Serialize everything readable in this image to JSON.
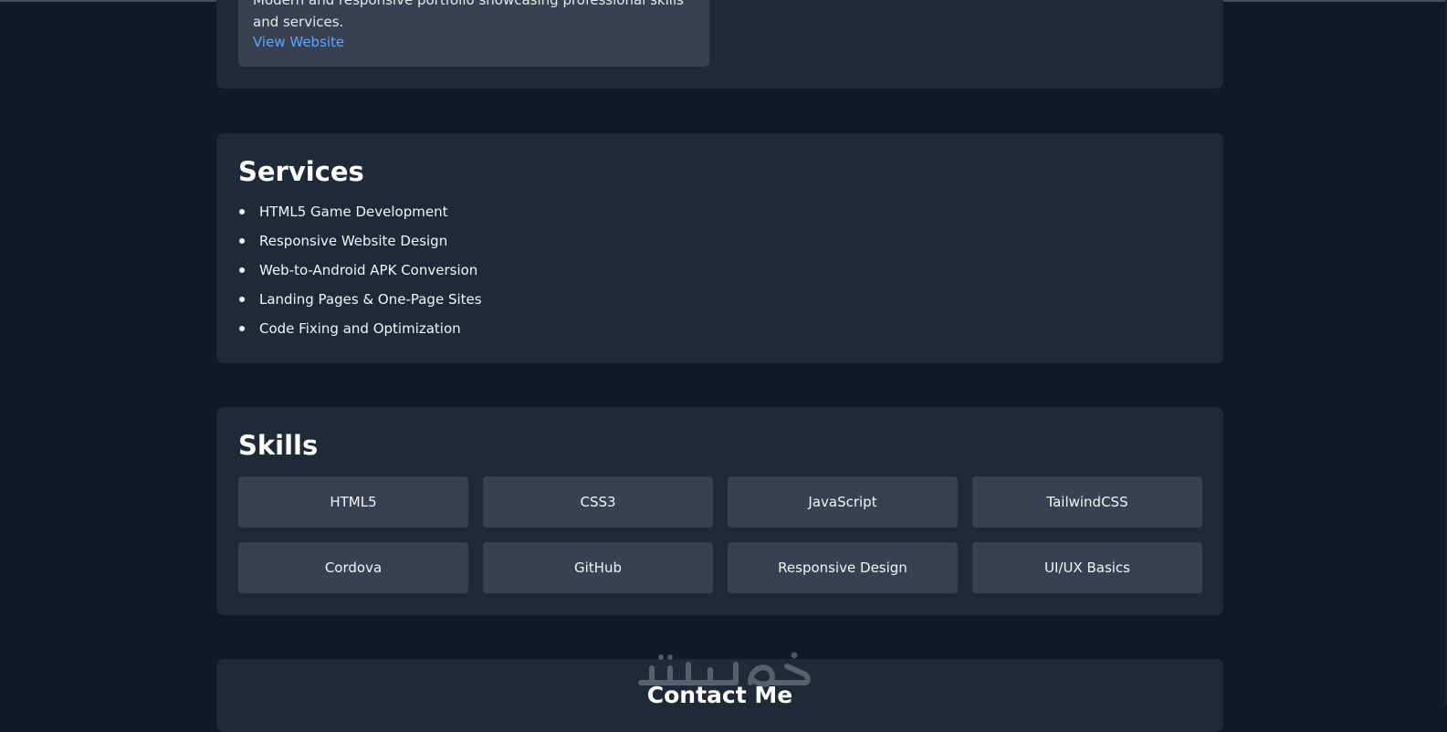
{
  "portfolio": {
    "project_description": "Modern and responsive portfolio showcasing professional skills and services.",
    "view_link": "View Website"
  },
  "services": {
    "title": "Services",
    "items": [
      "HTML5 Game Development",
      "Responsive Website Design",
      "Web-to-Android APK Conversion",
      "Landing Pages & One-Page Sites",
      "Code Fixing and Optimization"
    ]
  },
  "skills": {
    "title": "Skills",
    "items": [
      "HTML5",
      "CSS3",
      "JavaScript",
      "TailwindCSS",
      "Cordova",
      "GitHub",
      "Responsive Design",
      "UI/UX Basics"
    ]
  },
  "contact": {
    "title": "Contact Me"
  },
  "watermark": {
    "text": "خمسات"
  },
  "colors": {
    "page_background": "#111827",
    "card_background": "#1f2937",
    "tile_background": "#374151",
    "link": "#60a5fa"
  }
}
